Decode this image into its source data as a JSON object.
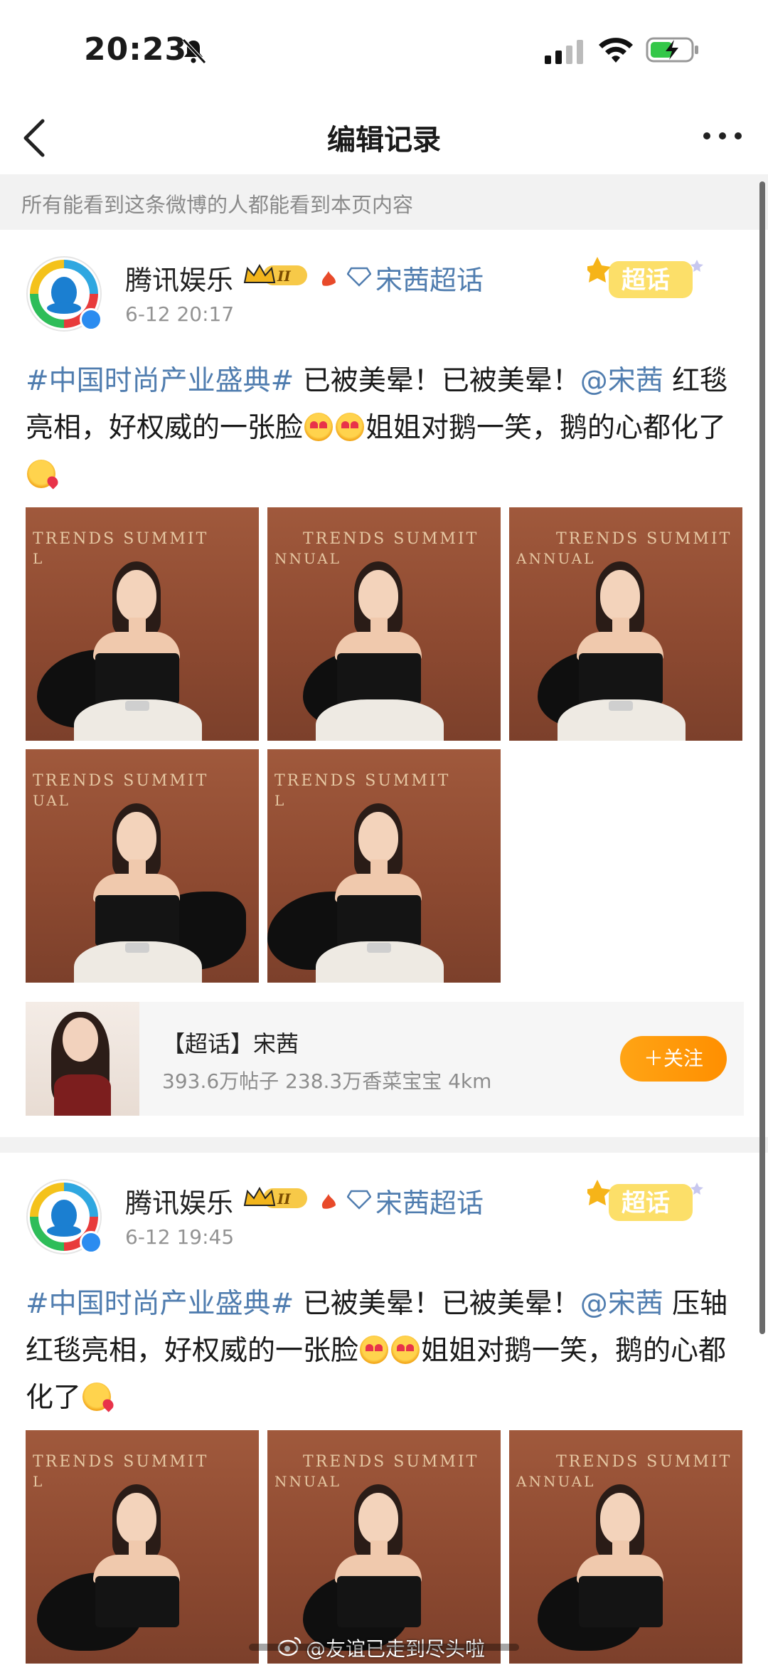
{
  "status_bar": {
    "time": "20:23"
  },
  "nav": {
    "title": "编辑记录"
  },
  "notice": "所有能看到这条微博的人都能看到本页内容",
  "posts": [
    {
      "author": "腾讯娱乐",
      "topic_link": "宋茜超话",
      "time": "6-12 20:17",
      "super_badge": "超话",
      "text": {
        "hashtag": "#中国时尚产业盛典#",
        "part1": " 已被美晕！已被美晕！",
        "mention": "@宋茜",
        "part2": " 红毯亮相，好权威的一张脸",
        "part3": "姐姐对鹅一笑，鹅的心都化了"
      },
      "photos": [
        {
          "banner": "TRENDS SUMMIT",
          "sub": "L"
        },
        {
          "banner": "TRENDS SUMMIT",
          "sub": "NNUAL"
        },
        {
          "banner": "TRENDS SUMMIT",
          "sub": "ANNUAL"
        },
        {
          "banner": "TRENDS SUMMIT",
          "sub": "UAL"
        },
        {
          "banner": "TRENDS SUMMIT",
          "sub": "L"
        }
      ],
      "topic_card": {
        "title": "【超话】宋茜",
        "stats": "393.6万帖子 238.3万香菜宝宝 4km",
        "follow": "＋关注"
      }
    },
    {
      "author": "腾讯娱乐",
      "topic_link": "宋茜超话",
      "time": "6-12 19:45",
      "super_badge": "超话",
      "text": {
        "hashtag": "#中国时尚产业盛典#",
        "part1": " 已被美晕！已被美晕！",
        "mention": "@宋茜",
        "part2": " 压轴红毯亮相，好权威的一张脸",
        "part3": "姐姐对鹅一笑，鹅的心都化了"
      },
      "photos": [
        {
          "banner": "TRENDS SUMMIT",
          "sub": "L"
        },
        {
          "banner": "TRENDS SUMMIT",
          "sub": "NNUAL"
        },
        {
          "banner": "TRENDS SUMMIT",
          "sub": "ANNUAL"
        }
      ]
    }
  ],
  "watermark": "@友谊已走到尽头啦",
  "colors": {
    "link": "#507daf",
    "follow": "#ff9a0a",
    "notice_bg": "#f2f2f2"
  }
}
